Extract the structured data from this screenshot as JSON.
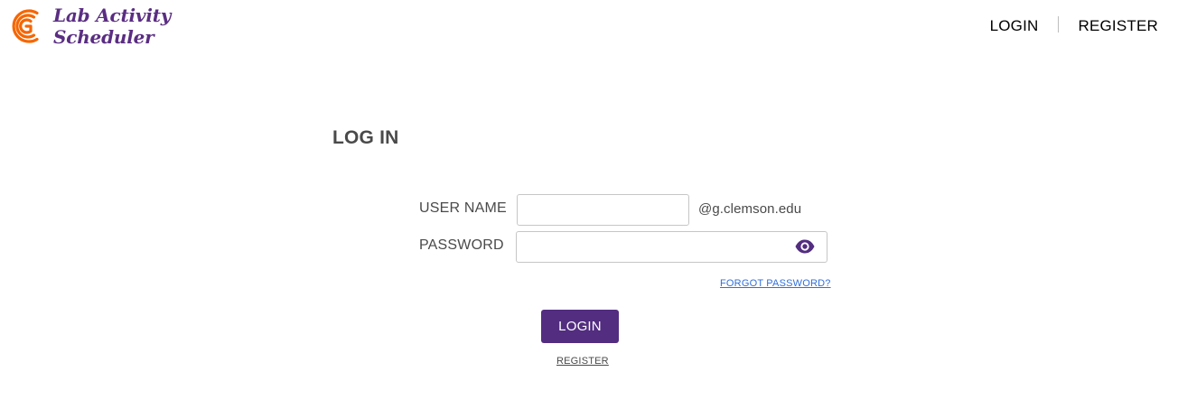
{
  "brand": {
    "line1": "Lab Activity",
    "line2": "Scheduler",
    "logo_icon": "clemson-c-logo-icon",
    "primary_color": "#522d80",
    "accent_color": "#f56600"
  },
  "nav": {
    "login": "LOGIN",
    "register": "REGISTER"
  },
  "page": {
    "title": "LOG IN"
  },
  "form": {
    "username_label": "USER NAME",
    "username_value": "",
    "domain_suffix": "@g.clemson.edu",
    "password_label": "PASSWORD",
    "password_value": "",
    "show_password_icon": "eye-icon",
    "forgot_password": "FORGOT PASSWORD?",
    "login_button": "LOGIN",
    "register_link": "REGISTER"
  }
}
